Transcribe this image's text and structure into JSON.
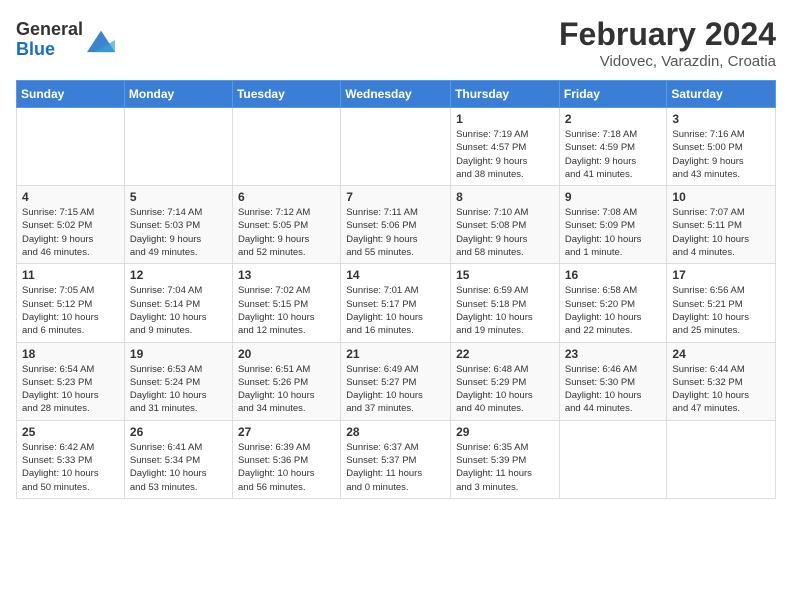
{
  "header": {
    "logo_general": "General",
    "logo_blue": "Blue",
    "title": "February 2024",
    "subtitle": "Vidovec, Varazdin, Croatia"
  },
  "days_of_week": [
    "Sunday",
    "Monday",
    "Tuesday",
    "Wednesday",
    "Thursday",
    "Friday",
    "Saturday"
  ],
  "weeks": [
    [
      {
        "day": "",
        "info": ""
      },
      {
        "day": "",
        "info": ""
      },
      {
        "day": "",
        "info": ""
      },
      {
        "day": "",
        "info": ""
      },
      {
        "day": "1",
        "info": "Sunrise: 7:19 AM\nSunset: 4:57 PM\nDaylight: 9 hours\nand 38 minutes."
      },
      {
        "day": "2",
        "info": "Sunrise: 7:18 AM\nSunset: 4:59 PM\nDaylight: 9 hours\nand 41 minutes."
      },
      {
        "day": "3",
        "info": "Sunrise: 7:16 AM\nSunset: 5:00 PM\nDaylight: 9 hours\nand 43 minutes."
      }
    ],
    [
      {
        "day": "4",
        "info": "Sunrise: 7:15 AM\nSunset: 5:02 PM\nDaylight: 9 hours\nand 46 minutes."
      },
      {
        "day": "5",
        "info": "Sunrise: 7:14 AM\nSunset: 5:03 PM\nDaylight: 9 hours\nand 49 minutes."
      },
      {
        "day": "6",
        "info": "Sunrise: 7:12 AM\nSunset: 5:05 PM\nDaylight: 9 hours\nand 52 minutes."
      },
      {
        "day": "7",
        "info": "Sunrise: 7:11 AM\nSunset: 5:06 PM\nDaylight: 9 hours\nand 55 minutes."
      },
      {
        "day": "8",
        "info": "Sunrise: 7:10 AM\nSunset: 5:08 PM\nDaylight: 9 hours\nand 58 minutes."
      },
      {
        "day": "9",
        "info": "Sunrise: 7:08 AM\nSunset: 5:09 PM\nDaylight: 10 hours\nand 1 minute."
      },
      {
        "day": "10",
        "info": "Sunrise: 7:07 AM\nSunset: 5:11 PM\nDaylight: 10 hours\nand 4 minutes."
      }
    ],
    [
      {
        "day": "11",
        "info": "Sunrise: 7:05 AM\nSunset: 5:12 PM\nDaylight: 10 hours\nand 6 minutes."
      },
      {
        "day": "12",
        "info": "Sunrise: 7:04 AM\nSunset: 5:14 PM\nDaylight: 10 hours\nand 9 minutes."
      },
      {
        "day": "13",
        "info": "Sunrise: 7:02 AM\nSunset: 5:15 PM\nDaylight: 10 hours\nand 12 minutes."
      },
      {
        "day": "14",
        "info": "Sunrise: 7:01 AM\nSunset: 5:17 PM\nDaylight: 10 hours\nand 16 minutes."
      },
      {
        "day": "15",
        "info": "Sunrise: 6:59 AM\nSunset: 5:18 PM\nDaylight: 10 hours\nand 19 minutes."
      },
      {
        "day": "16",
        "info": "Sunrise: 6:58 AM\nSunset: 5:20 PM\nDaylight: 10 hours\nand 22 minutes."
      },
      {
        "day": "17",
        "info": "Sunrise: 6:56 AM\nSunset: 5:21 PM\nDaylight: 10 hours\nand 25 minutes."
      }
    ],
    [
      {
        "day": "18",
        "info": "Sunrise: 6:54 AM\nSunset: 5:23 PM\nDaylight: 10 hours\nand 28 minutes."
      },
      {
        "day": "19",
        "info": "Sunrise: 6:53 AM\nSunset: 5:24 PM\nDaylight: 10 hours\nand 31 minutes."
      },
      {
        "day": "20",
        "info": "Sunrise: 6:51 AM\nSunset: 5:26 PM\nDaylight: 10 hours\nand 34 minutes."
      },
      {
        "day": "21",
        "info": "Sunrise: 6:49 AM\nSunset: 5:27 PM\nDaylight: 10 hours\nand 37 minutes."
      },
      {
        "day": "22",
        "info": "Sunrise: 6:48 AM\nSunset: 5:29 PM\nDaylight: 10 hours\nand 40 minutes."
      },
      {
        "day": "23",
        "info": "Sunrise: 6:46 AM\nSunset: 5:30 PM\nDaylight: 10 hours\nand 44 minutes."
      },
      {
        "day": "24",
        "info": "Sunrise: 6:44 AM\nSunset: 5:32 PM\nDaylight: 10 hours\nand 47 minutes."
      }
    ],
    [
      {
        "day": "25",
        "info": "Sunrise: 6:42 AM\nSunset: 5:33 PM\nDaylight: 10 hours\nand 50 minutes."
      },
      {
        "day": "26",
        "info": "Sunrise: 6:41 AM\nSunset: 5:34 PM\nDaylight: 10 hours\nand 53 minutes."
      },
      {
        "day": "27",
        "info": "Sunrise: 6:39 AM\nSunset: 5:36 PM\nDaylight: 10 hours\nand 56 minutes."
      },
      {
        "day": "28",
        "info": "Sunrise: 6:37 AM\nSunset: 5:37 PM\nDaylight: 11 hours\nand 0 minutes."
      },
      {
        "day": "29",
        "info": "Sunrise: 6:35 AM\nSunset: 5:39 PM\nDaylight: 11 hours\nand 3 minutes."
      },
      {
        "day": "",
        "info": ""
      },
      {
        "day": "",
        "info": ""
      }
    ]
  ]
}
